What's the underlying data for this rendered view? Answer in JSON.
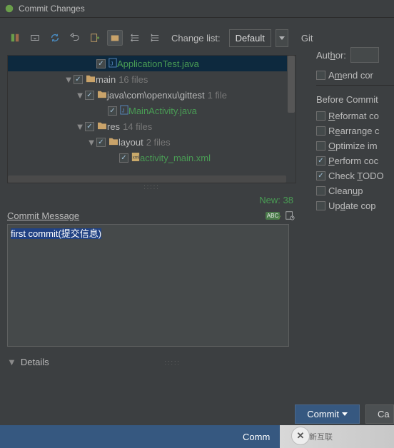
{
  "titlebar": {
    "text": "Commit Changes"
  },
  "toolbar": {
    "changelist_label": "Change list:",
    "changelist_value": "Default",
    "vcs_label": "Git"
  },
  "tree": {
    "rows": [
      {
        "indent": 110,
        "arrow": "",
        "checked": true,
        "icon": "java",
        "name": "ApplicationTest.java",
        "suffix": "",
        "cls": "file-new",
        "selected": true
      },
      {
        "indent": 78,
        "arrow": "▼",
        "checked": true,
        "icon": "folder",
        "name": "main",
        "suffix": "16 files",
        "cls": "",
        "selected": false
      },
      {
        "indent": 94,
        "arrow": "▼",
        "checked": true,
        "icon": "folder",
        "name": "java\\com\\openxu\\gittest",
        "suffix": "1 file",
        "cls": "",
        "selected": false
      },
      {
        "indent": 126,
        "arrow": "",
        "checked": true,
        "icon": "java",
        "name": "MainActivity.java",
        "suffix": "",
        "cls": "file-new",
        "selected": false
      },
      {
        "indent": 94,
        "arrow": "▼",
        "checked": true,
        "icon": "folder",
        "name": "res",
        "suffix": "14 files",
        "cls": "",
        "selected": false
      },
      {
        "indent": 110,
        "arrow": "▼",
        "checked": true,
        "icon": "folder",
        "name": "layout",
        "suffix": "2 files",
        "cls": "",
        "selected": false
      },
      {
        "indent": 142,
        "arrow": "",
        "checked": true,
        "icon": "xml",
        "name": "activity_main.xml",
        "suffix": "",
        "cls": "file-new",
        "selected": false
      }
    ]
  },
  "status": {
    "new_label": "New: 38"
  },
  "right": {
    "author_label_pre": "Aut",
    "author_label_u": "h",
    "author_label_post": "or:",
    "amend_label_pre": "A",
    "amend_label_u": "m",
    "amend_label_post": "end cor",
    "before_commit_label": "Before Commit",
    "options": [
      {
        "checked": false,
        "pre": "",
        "u": "R",
        "post": "eformat co"
      },
      {
        "checked": false,
        "pre": "R",
        "u": "e",
        "post": "arrange c"
      },
      {
        "checked": false,
        "pre": "",
        "u": "O",
        "post": "ptimize im"
      },
      {
        "checked": true,
        "pre": "",
        "u": "P",
        "post": "erform coc"
      },
      {
        "checked": true,
        "pre": "Check ",
        "u": "T",
        "post": "ODO"
      },
      {
        "checked": false,
        "pre": "Clean",
        "u": "u",
        "post": "p"
      },
      {
        "checked": false,
        "pre": "Up",
        "u": "d",
        "post": "ate cop"
      }
    ]
  },
  "commit": {
    "label": "Commit Message",
    "text": "first commit(提交信息)"
  },
  "details": {
    "label": "Details"
  },
  "buttons": {
    "commit": "Commit",
    "cancel": "Ca"
  },
  "watermark": {
    "bar_text": "Comm",
    "brand": "创新互联"
  }
}
